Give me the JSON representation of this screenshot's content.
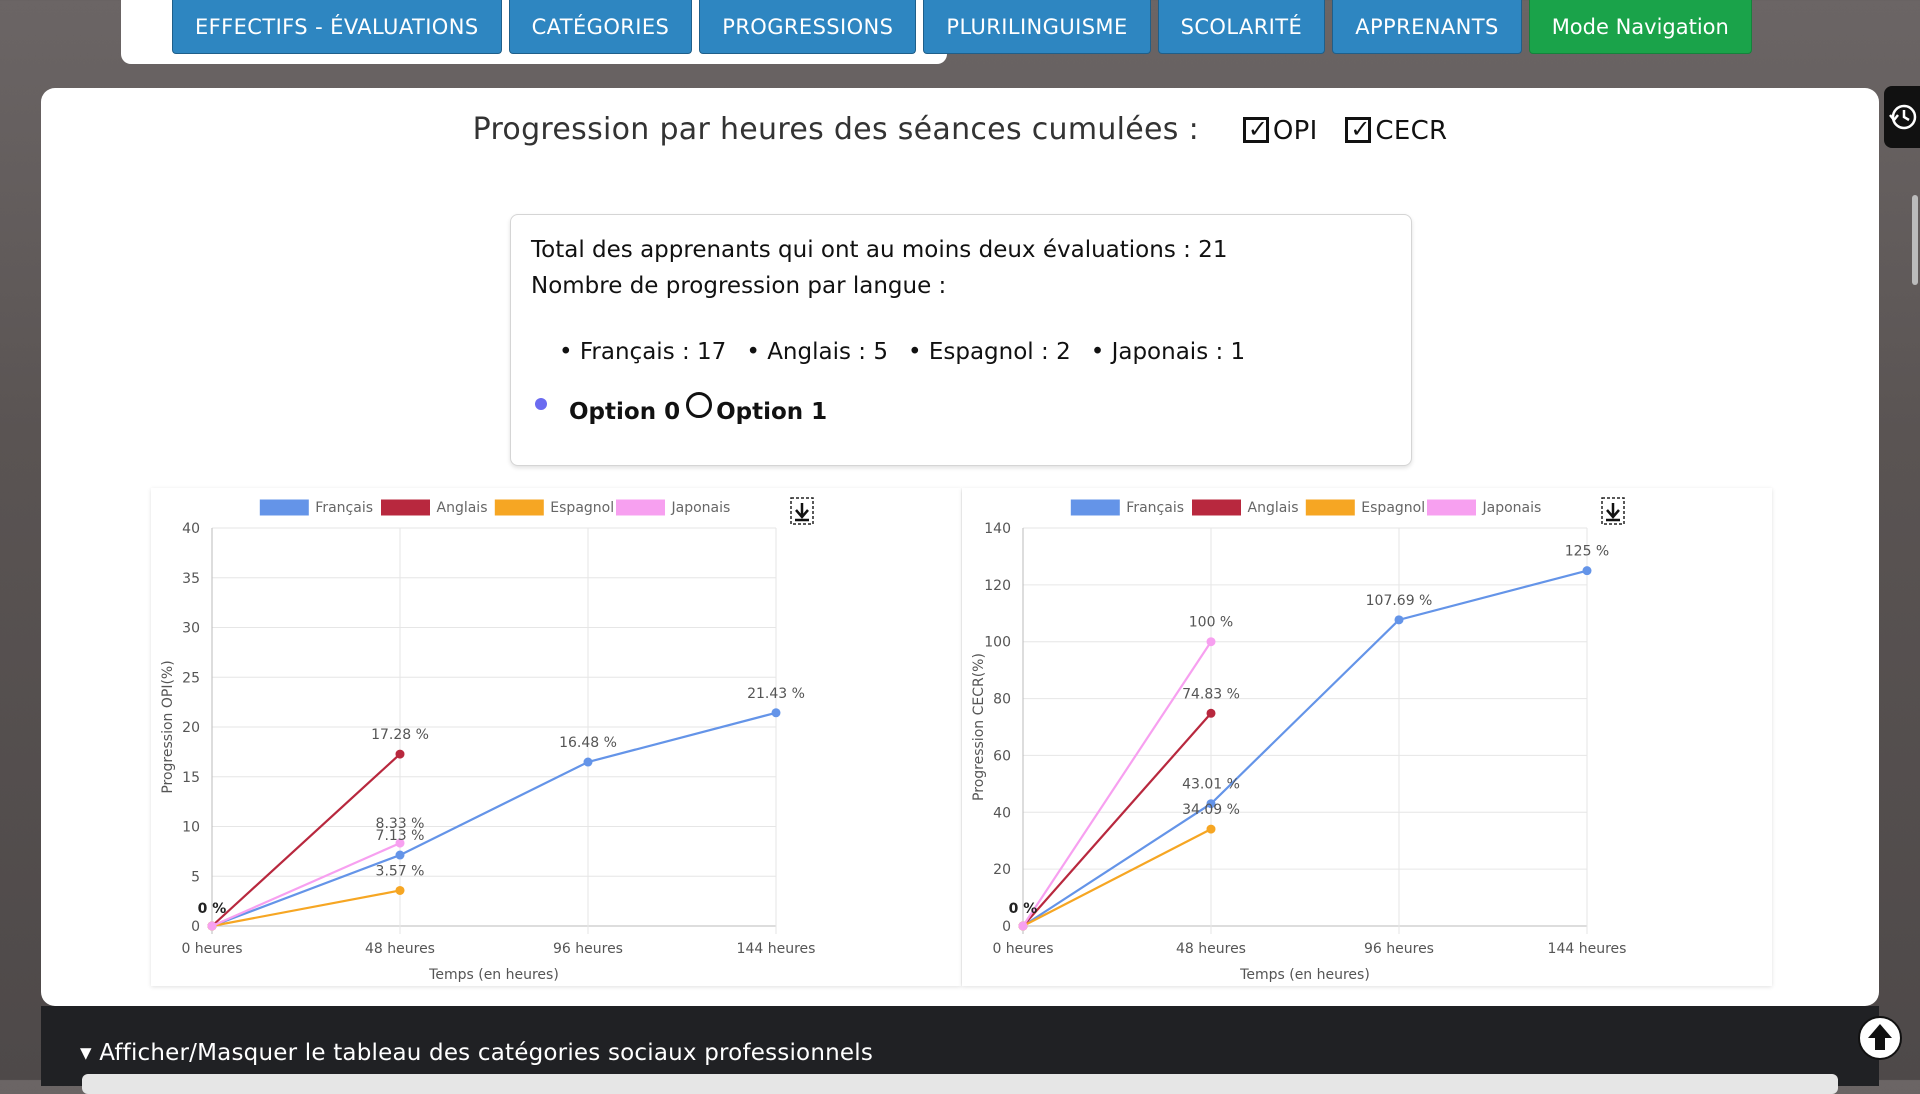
{
  "tabs": [
    "EFFECTIFS - ÉVALUATIONS",
    "CATÉGORIES",
    "PROGRESSIONS",
    "PLURILINGUISME",
    "SCOLARITÉ",
    "APPRENANTS",
    "Mode Navigation"
  ],
  "heading": {
    "title": "Progression par heures des séances cumulées :",
    "check_opi": "OPI",
    "check_cecr": "CECR"
  },
  "info": {
    "total_line": "Total des apprenants qui ont au moins deux évaluations : 21",
    "count_title": "Nombre de progression par langue :",
    "langs": [
      "• Français : 17",
      "• Anglais : 5",
      "• Espagnol : 2",
      "• Japonais : 1"
    ],
    "option0": "Option 0",
    "option1": "Option 1"
  },
  "colors": {
    "fr": "#6494e8",
    "en": "#b8283e",
    "es": "#f6a623",
    "ja": "#f7a0f0",
    "tab": "#2e86c1",
    "nav": "#1aa34a"
  },
  "bottom": {
    "toggle": "▾ Afficher/Masquer le tableau des catégories sociaux professionnels"
  },
  "chart_data": [
    {
      "type": "line",
      "categories": [
        "0 heures",
        "48 heures",
        "96 heures",
        "144 heures"
      ],
      "x": [
        0,
        48,
        96,
        144
      ],
      "xlabel": "Temps (en heures)",
      "ylabel": "Progression OPI(%)",
      "ylim": [
        0,
        40
      ],
      "yticks": [
        0,
        5,
        10,
        15,
        20,
        25,
        30,
        35,
        40
      ],
      "legend": "top",
      "grid": true,
      "series": [
        {
          "name": "Français",
          "color": "#6494e8",
          "points": [
            [
              0,
              0
            ],
            [
              48,
              7.13
            ],
            [
              96,
              16.48
            ],
            [
              144,
              21.43
            ]
          ],
          "labels": [
            "0 %",
            "7.13 %",
            "16.48 %",
            "21.43 %"
          ]
        },
        {
          "name": "Anglais",
          "color": "#b8283e",
          "points": [
            [
              0,
              0
            ],
            [
              48,
              17.28
            ]
          ],
          "labels": [
            "",
            "17.28 %"
          ]
        },
        {
          "name": "Espagnol",
          "color": "#f6a623",
          "points": [
            [
              0,
              0
            ],
            [
              48,
              3.57
            ]
          ],
          "labels": [
            "",
            "3.57 %"
          ]
        },
        {
          "name": "Japonais",
          "color": "#f7a0f0",
          "points": [
            [
              0,
              0
            ],
            [
              48,
              8.33
            ]
          ],
          "labels": [
            "",
            "8.33 %"
          ]
        }
      ]
    },
    {
      "type": "line",
      "categories": [
        "0 heures",
        "48 heures",
        "96 heures",
        "144 heures"
      ],
      "x": [
        0,
        48,
        96,
        144
      ],
      "xlabel": "Temps (en heures)",
      "ylabel": "Progression CECR(%)",
      "ylim": [
        0,
        140
      ],
      "yticks": [
        0,
        20,
        40,
        60,
        80,
        100,
        120,
        140
      ],
      "legend": "top",
      "grid": true,
      "series": [
        {
          "name": "Français",
          "color": "#6494e8",
          "points": [
            [
              0,
              0
            ],
            [
              48,
              43.01
            ],
            [
              96,
              107.69
            ],
            [
              144,
              125
            ]
          ],
          "labels": [
            "0 %",
            "43.01 %",
            "107.69 %",
            "125 %"
          ]
        },
        {
          "name": "Anglais",
          "color": "#b8283e",
          "points": [
            [
              0,
              0
            ],
            [
              48,
              74.83
            ]
          ],
          "labels": [
            "",
            "74.83 %"
          ]
        },
        {
          "name": "Espagnol",
          "color": "#f6a623",
          "points": [
            [
              0,
              0
            ],
            [
              48,
              34.09
            ]
          ],
          "labels": [
            "",
            "34.09 %"
          ]
        },
        {
          "name": "Japonais",
          "color": "#f7a0f0",
          "points": [
            [
              0,
              0
            ],
            [
              48,
              100
            ]
          ],
          "labels": [
            "",
            "100 %"
          ]
        }
      ]
    }
  ]
}
